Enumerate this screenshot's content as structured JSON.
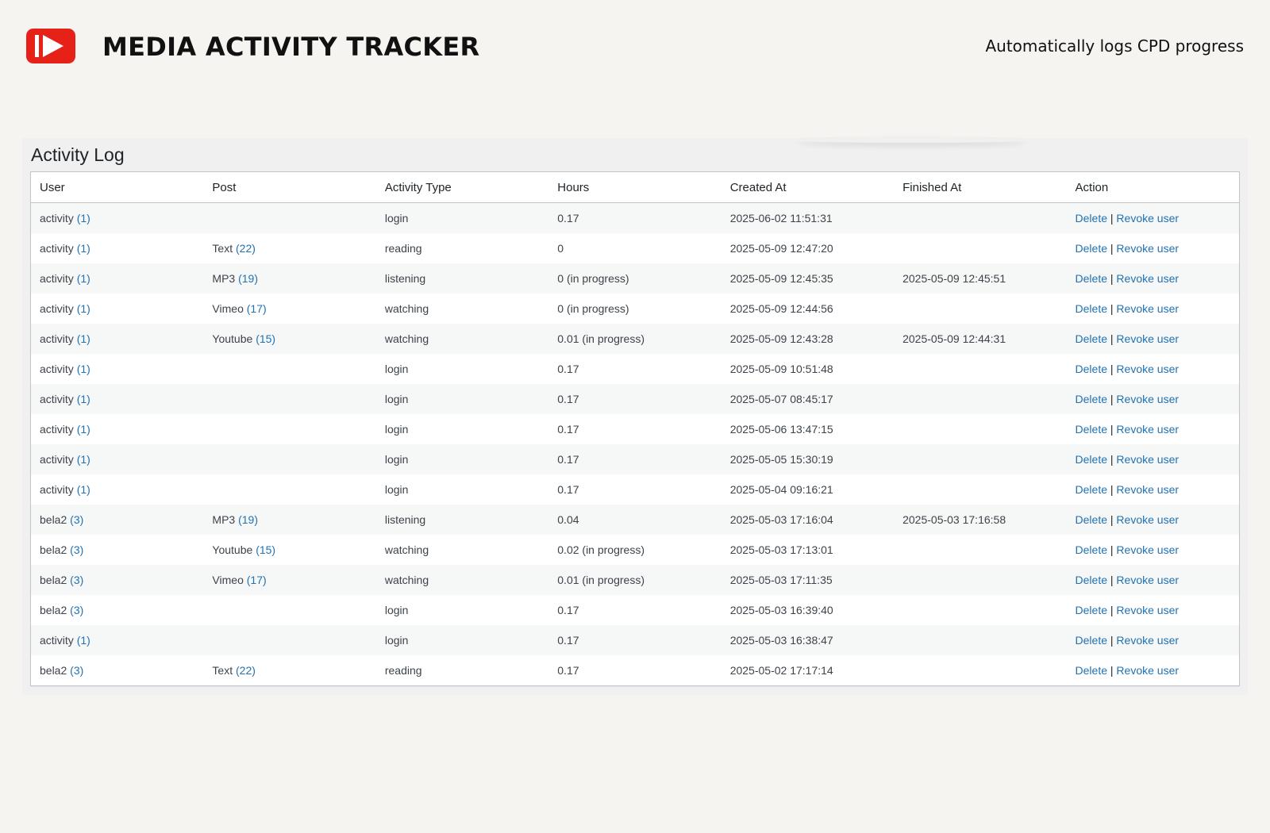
{
  "header": {
    "logo_icon": "play-button-icon",
    "title": "MEDIA ACTIVITY TRACKER",
    "tagline": "Automatically logs CPD progress",
    "brand_color": "#e62117"
  },
  "panel": {
    "title": "Activity Log"
  },
  "table": {
    "columns": [
      "User",
      "Post",
      "Activity Type",
      "Hours",
      "Created At",
      "Finished At",
      "Action"
    ],
    "action_labels": {
      "delete": "Delete",
      "separator": "|",
      "revoke": "Revoke user"
    },
    "rows": [
      {
        "user": "activity",
        "user_id": "(1)",
        "post": "",
        "post_id": "",
        "type": "login",
        "hours": "0.17",
        "created": "2025-06-02 11:51:31",
        "finished": ""
      },
      {
        "user": "activity",
        "user_id": "(1)",
        "post": "Text",
        "post_id": "(22)",
        "type": "reading",
        "hours": "0",
        "created": "2025-05-09 12:47:20",
        "finished": ""
      },
      {
        "user": "activity",
        "user_id": "(1)",
        "post": "MP3",
        "post_id": "(19)",
        "type": "listening",
        "hours": "0 (in progress)",
        "created": "2025-05-09 12:45:35",
        "finished": "2025-05-09 12:45:51"
      },
      {
        "user": "activity",
        "user_id": "(1)",
        "post": "Vimeo",
        "post_id": "(17)",
        "type": "watching",
        "hours": "0 (in progress)",
        "created": "2025-05-09 12:44:56",
        "finished": ""
      },
      {
        "user": "activity",
        "user_id": "(1)",
        "post": "Youtube",
        "post_id": "(15)",
        "type": "watching",
        "hours": "0.01 (in progress)",
        "created": "2025-05-09 12:43:28",
        "finished": "2025-05-09 12:44:31"
      },
      {
        "user": "activity",
        "user_id": "(1)",
        "post": "",
        "post_id": "",
        "type": "login",
        "hours": "0.17",
        "created": "2025-05-09 10:51:48",
        "finished": ""
      },
      {
        "user": "activity",
        "user_id": "(1)",
        "post": "",
        "post_id": "",
        "type": "login",
        "hours": "0.17",
        "created": "2025-05-07 08:45:17",
        "finished": ""
      },
      {
        "user": "activity",
        "user_id": "(1)",
        "post": "",
        "post_id": "",
        "type": "login",
        "hours": "0.17",
        "created": "2025-05-06 13:47:15",
        "finished": ""
      },
      {
        "user": "activity",
        "user_id": "(1)",
        "post": "",
        "post_id": "",
        "type": "login",
        "hours": "0.17",
        "created": "2025-05-05 15:30:19",
        "finished": ""
      },
      {
        "user": "activity",
        "user_id": "(1)",
        "post": "",
        "post_id": "",
        "type": "login",
        "hours": "0.17",
        "created": "2025-05-04 09:16:21",
        "finished": ""
      },
      {
        "user": "bela2",
        "user_id": "(3)",
        "post": "MP3",
        "post_id": "(19)",
        "type": "listening",
        "hours": "0.04",
        "created": "2025-05-03 17:16:04",
        "finished": "2025-05-03 17:16:58"
      },
      {
        "user": "bela2",
        "user_id": "(3)",
        "post": "Youtube",
        "post_id": "(15)",
        "type": "watching",
        "hours": "0.02 (in progress)",
        "created": "2025-05-03 17:13:01",
        "finished": ""
      },
      {
        "user": "bela2",
        "user_id": "(3)",
        "post": "Vimeo",
        "post_id": "(17)",
        "type": "watching",
        "hours": "0.01 (in progress)",
        "created": "2025-05-03 17:11:35",
        "finished": ""
      },
      {
        "user": "bela2",
        "user_id": "(3)",
        "post": "",
        "post_id": "",
        "type": "login",
        "hours": "0.17",
        "created": "2025-05-03 16:39:40",
        "finished": ""
      },
      {
        "user": "activity",
        "user_id": "(1)",
        "post": "",
        "post_id": "",
        "type": "login",
        "hours": "0.17",
        "created": "2025-05-03 16:38:47",
        "finished": ""
      },
      {
        "user": "bela2",
        "user_id": "(3)",
        "post": "Text",
        "post_id": "(22)",
        "type": "reading",
        "hours": "0.17",
        "created": "2025-05-02 17:17:14",
        "finished": ""
      }
    ]
  }
}
